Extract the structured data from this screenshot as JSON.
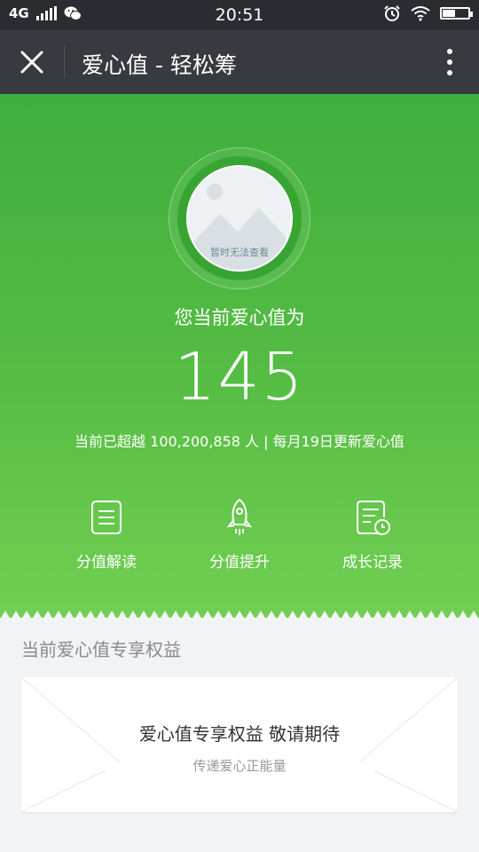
{
  "status_bar": {
    "network": "4G",
    "time": "20:51"
  },
  "title_bar": {
    "title": "爱心值 - 轻松筹"
  },
  "hero": {
    "avatar_caption": "暂时无法查看",
    "current_label": "您当前爱心值为",
    "score": "145",
    "subline": "当前已超越 100,200,858 人  |  每月19日更新爱心值",
    "actions": [
      {
        "label": "分值解读",
        "icon": "document-icon"
      },
      {
        "label": "分值提升",
        "icon": "rocket-icon"
      },
      {
        "label": "成长记录",
        "icon": "record-clock-icon"
      }
    ]
  },
  "benefits": {
    "section_title": "当前爱心值专享权益",
    "card_title": "爱心值专享权益 敬请期待",
    "card_subtitle": "传递爱心正能量"
  },
  "colors": {
    "header_dark": "#393a3f",
    "status_bar": "#2b2c31",
    "green_top": "#3fae3c",
    "green_bottom": "#71cf52",
    "page_bg": "#f2f3f5"
  }
}
